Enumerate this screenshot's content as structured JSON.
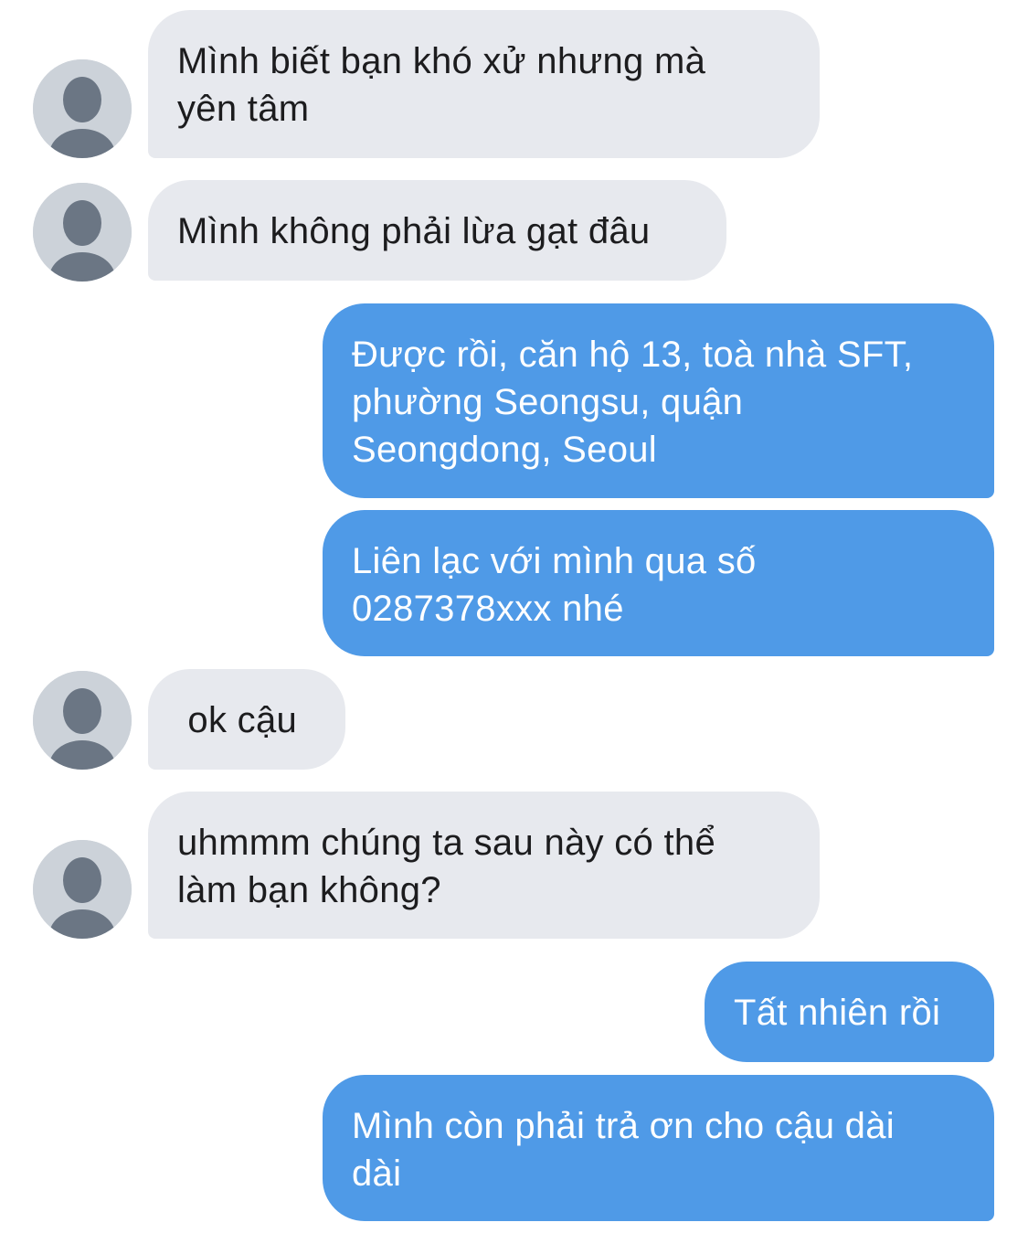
{
  "conversation": {
    "messages": [
      {
        "side": "incoming",
        "text": "Mình biết bạn khó xử nhưng mà\nyên tâm"
      },
      {
        "side": "incoming",
        "text": "Mình không phải lừa gạt đâu"
      },
      {
        "side": "outgoing",
        "text": "Được rồi, căn hộ 13, toà nhà SFT,\nphường Seongsu, quận\nSeongdong, Seoul"
      },
      {
        "side": "outgoing",
        "text": "Liên lạc với mình qua số\n0287378xxx nhé"
      },
      {
        "side": "incoming",
        "text": " ok cậu"
      },
      {
        "side": "incoming",
        "text": "uhmmm chúng ta sau này có thể\nlàm bạn không?"
      },
      {
        "side": "outgoing",
        "text": "Tất nhiên rồi"
      },
      {
        "side": "outgoing",
        "text": "Mình còn phải trả ơn cho cậu dài\ndài"
      }
    ],
    "avatar_icon": "default-user-icon"
  },
  "colors": {
    "incoming_bubble": "#e7e9ee",
    "outgoing_bubble": "#4f9ae7",
    "avatar_bg": "#ccd2d9",
    "avatar_fg": "#6b7684"
  }
}
